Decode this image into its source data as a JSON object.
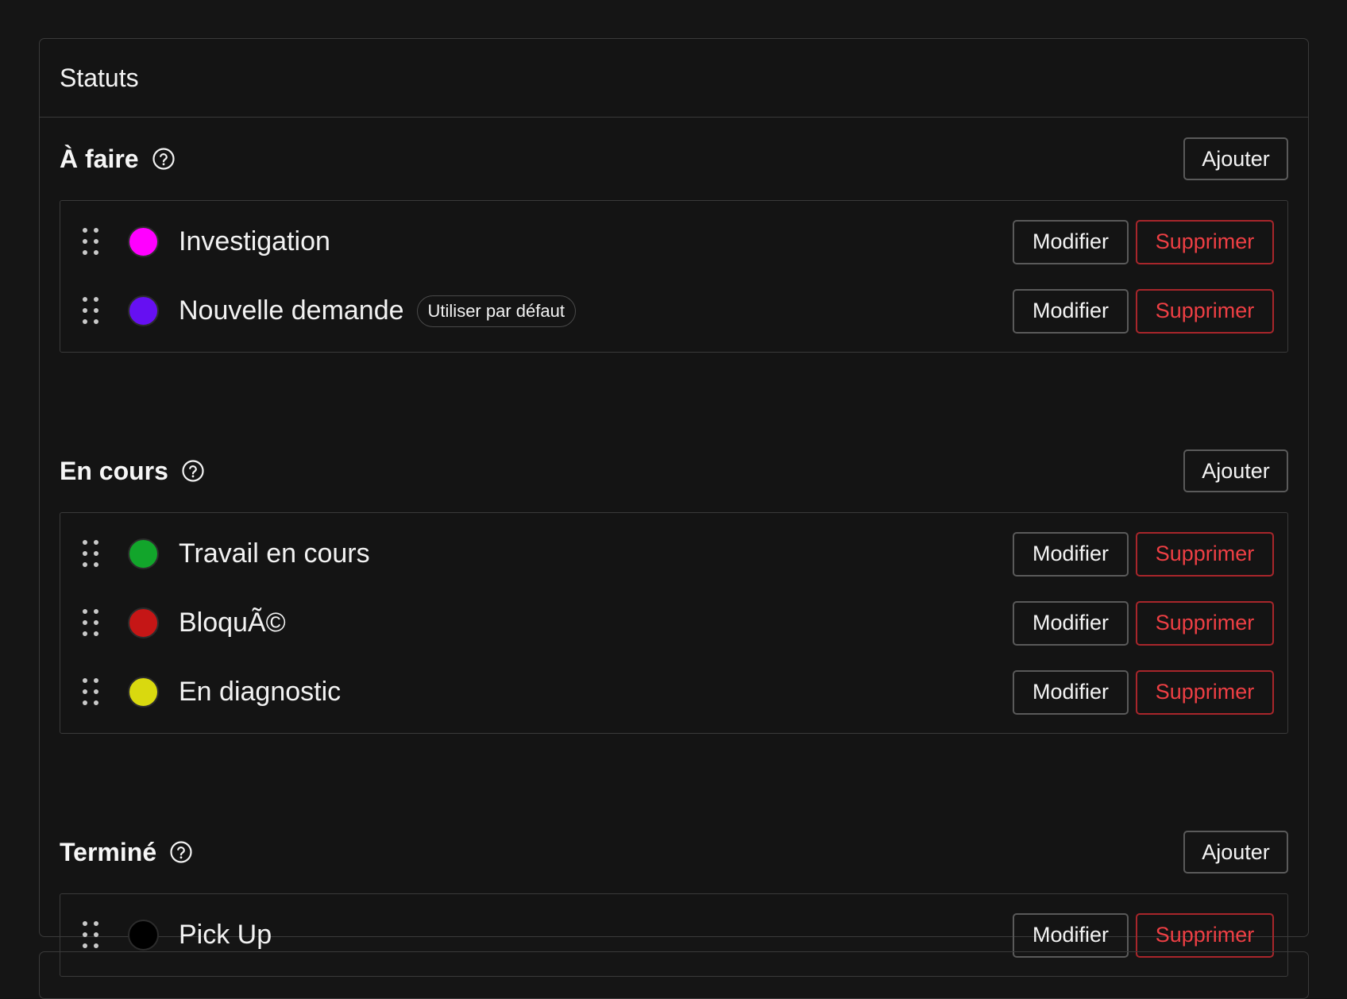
{
  "panel": {
    "title": "Statuts"
  },
  "actions": {
    "add": "Ajouter",
    "edit": "Modifier",
    "delete": "Supprimer",
    "default_badge": "Utiliser par défaut"
  },
  "icons": {
    "help": "help-circle-icon",
    "drag": "drag-handle-icon"
  },
  "colors": {
    "delete_accent": "#ee3f44"
  },
  "sections": [
    {
      "title": "À faire",
      "items": [
        {
          "label": "Investigation",
          "color": "#ff00ff",
          "is_default": false
        },
        {
          "label": "Nouvelle demande",
          "color": "#6610f2",
          "is_default": true
        }
      ]
    },
    {
      "title": "En cours",
      "items": [
        {
          "label": "Travail en cours",
          "color": "#12a52b",
          "is_default": false
        },
        {
          "label": "BloquÃ©",
          "color": "#c51616",
          "is_default": false
        },
        {
          "label": "En diagnostic",
          "color": "#d9d90f",
          "is_default": false
        }
      ]
    },
    {
      "title": "Terminé",
      "items": [
        {
          "label": "Pick Up",
          "color": "#000000",
          "is_default": false
        }
      ]
    }
  ]
}
